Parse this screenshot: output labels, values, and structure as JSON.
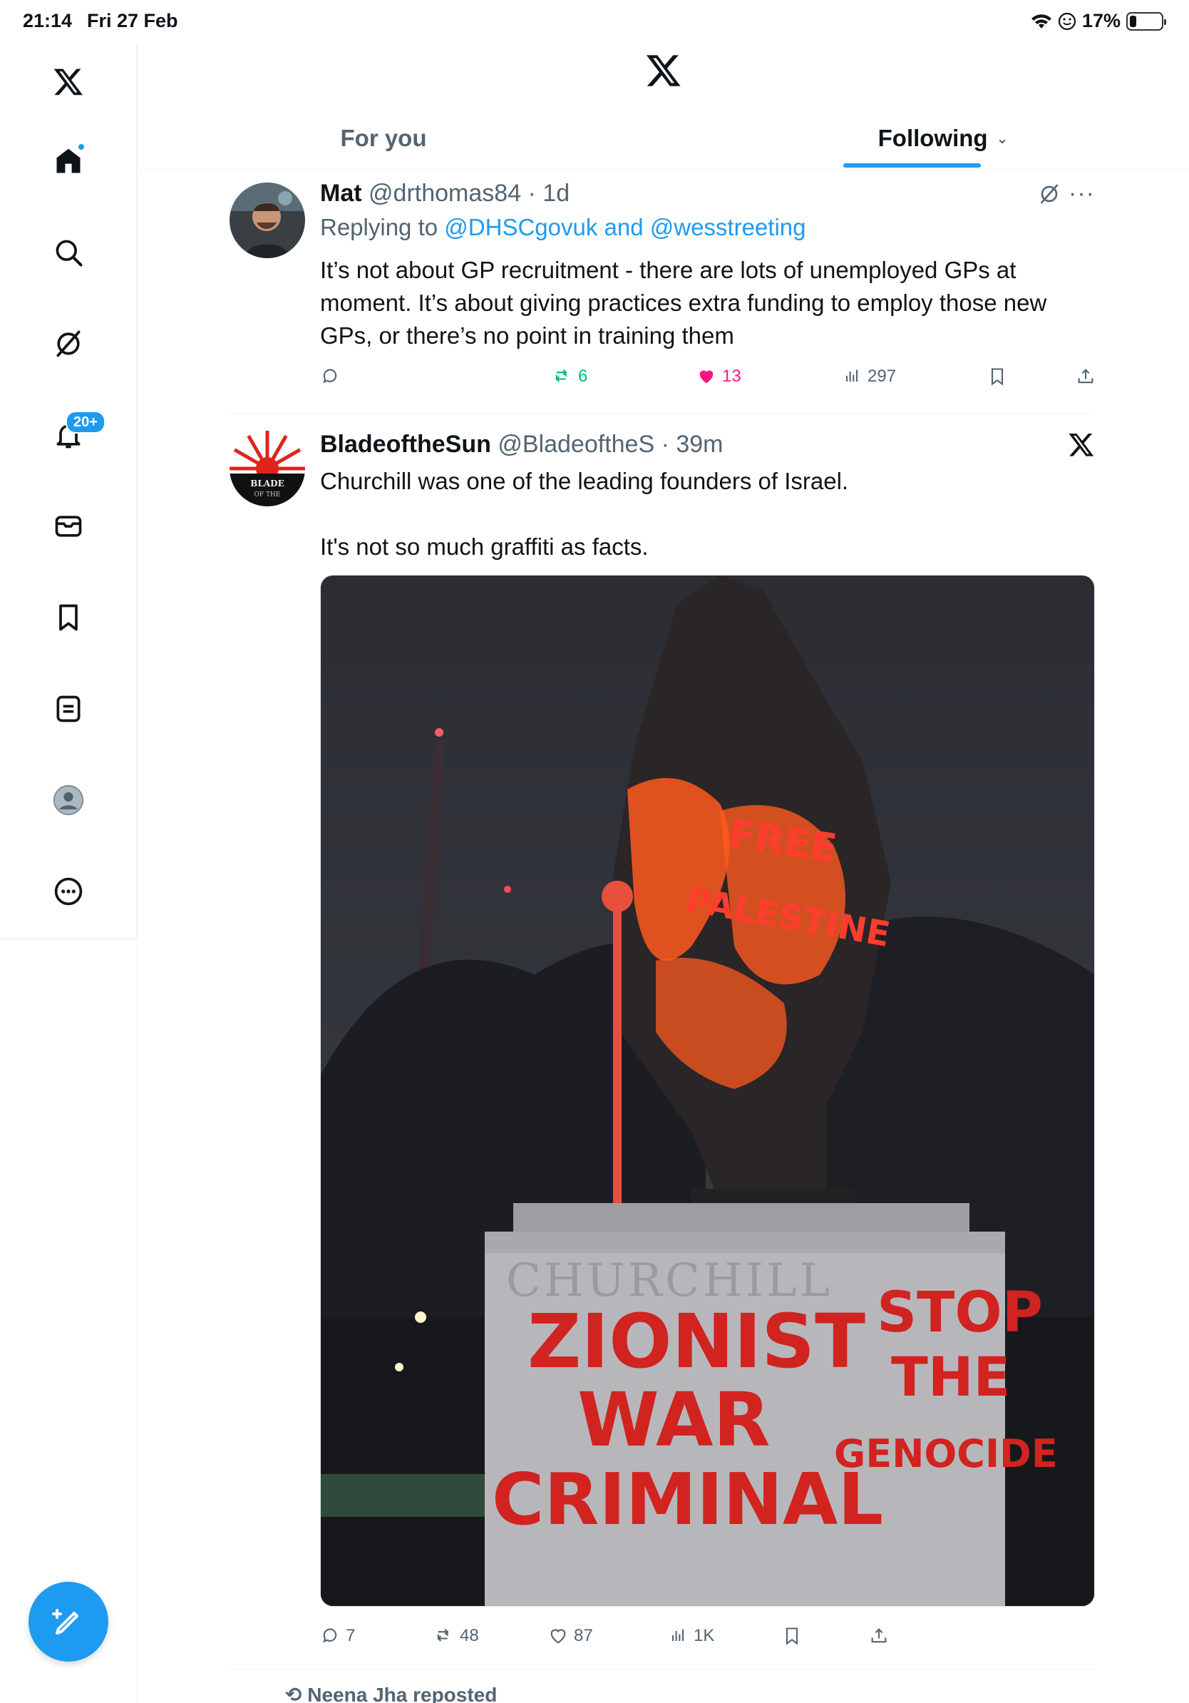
{
  "status_bar": {
    "time": "21:14",
    "date": "Fri 27 Feb",
    "battery": "17%"
  },
  "sidebar": {
    "items": [
      {
        "name": "x-logo-icon"
      },
      {
        "name": "home-icon"
      },
      {
        "name": "search-icon"
      },
      {
        "name": "grok-icon"
      },
      {
        "name": "notifications-icon",
        "badge": "20+"
      },
      {
        "name": "messages-icon"
      },
      {
        "name": "bookmarks-icon"
      },
      {
        "name": "lists-icon"
      },
      {
        "name": "profile-icon"
      },
      {
        "name": "more-icon"
      }
    ],
    "compose": "compose-icon"
  },
  "tabs": [
    {
      "label": "For you",
      "active": false
    },
    {
      "label": "Following",
      "active": true
    }
  ],
  "tweets": [
    {
      "name": "Mat",
      "handle": "@drthomas84",
      "time": "1d",
      "replying_prefix": "Replying to",
      "replying_to": "@DHSCgovuk and @wesstreeting",
      "text": "It’s not about GP recruitment - there are lots of unemployed GPs at moment. It’s about giving practices extra funding to employ those new GPs, or there’s no point in training them",
      "stats": {
        "replies": "",
        "reposts": "6",
        "likes": "13",
        "views": "297"
      }
    },
    {
      "name": "BladeoftheSun",
      "handle": "@BladeoftheS",
      "time": "39m",
      "text_line1": "Churchill was one of the leading founders of Israel.",
      "text_line2": "It's not so much graffiti as facts.",
      "image": {
        "plinth_text": "CHURCHILL",
        "graffiti_left": [
          "ZIONIST",
          "WAR",
          "CRIMINAL"
        ],
        "graffiti_right": [
          "STOP",
          "THE",
          "GENOCIDE"
        ],
        "graffiti_body": [
          "FREE",
          "PALESTINE"
        ]
      },
      "stats": {
        "replies": "7",
        "reposts": "48",
        "likes": "87",
        "views": "1K"
      }
    }
  ],
  "next_item": {
    "text": "Neena Jha reposted"
  },
  "colors": {
    "accent": "#1d9bf0",
    "like": "#f91880",
    "repost": "#00ba7c",
    "muted": "#536471"
  }
}
